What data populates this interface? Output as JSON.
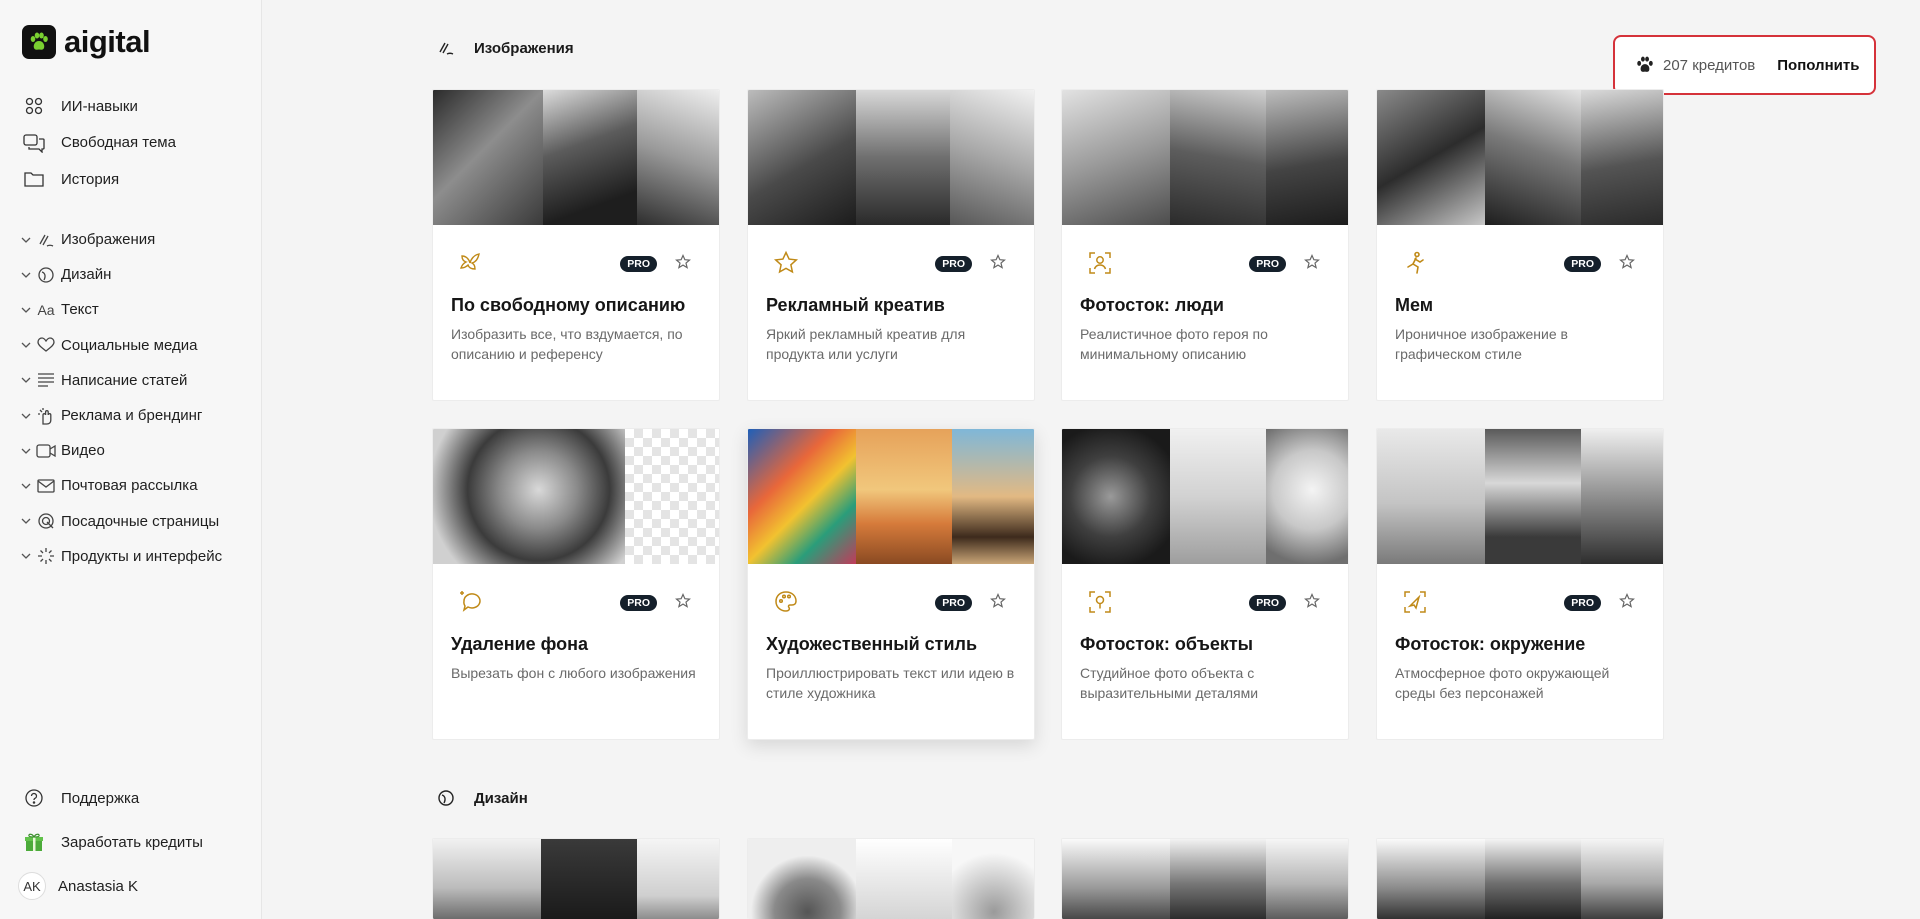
{
  "app": {
    "name": "aigital"
  },
  "sidebar": {
    "top": [
      {
        "label": "ИИ-навыки",
        "icon": "grid-icon"
      },
      {
        "label": "Свободная тема",
        "icon": "chat-icon"
      },
      {
        "label": "История",
        "icon": "folder-icon"
      }
    ],
    "categories": [
      {
        "label": "Изображения",
        "icon": "brush-icon"
      },
      {
        "label": "Дизайн",
        "icon": "palette-icon"
      },
      {
        "label": "Текст",
        "icon": "text-icon",
        "glyph": "Aa"
      },
      {
        "label": "Социальные медиа",
        "icon": "heart-icon"
      },
      {
        "label": "Написание статей",
        "icon": "lines-icon"
      },
      {
        "label": "Реклама и брендинг",
        "icon": "hand-icon"
      },
      {
        "label": "Видео",
        "icon": "video-icon"
      },
      {
        "label": "Почтовая рассылка",
        "icon": "mail-icon"
      },
      {
        "label": "Посадочные страницы",
        "icon": "target-icon"
      },
      {
        "label": "Продукты и интерфейс",
        "icon": "sparkle-icon"
      }
    ],
    "bottom": {
      "support": "Поддержка",
      "earn": "Заработать кредиты",
      "user_initials": "AK",
      "user_name": "Anastasia K"
    }
  },
  "credits": {
    "amount": "207 кредитов",
    "topup": "Пополнить"
  },
  "sections": [
    {
      "title": "Изображения",
      "cards": [
        {
          "title": "По свободному описанию",
          "desc": "Изобразить все, что вздумается, по описанию и референсу",
          "badge": "PRO",
          "icon": "bird-icon"
        },
        {
          "title": "Рекламный креатив",
          "desc": "Яркий рекламный креатив для продукта или услуги",
          "badge": "PRO",
          "icon": "star-outline-icon"
        },
        {
          "title": "Фотосток: люди",
          "desc": "Реалистичное фото героя по минимальному описанию",
          "badge": "PRO",
          "icon": "person-frame-icon"
        },
        {
          "title": "Мем",
          "desc": "Ироничное изображение в графическом стиле",
          "badge": "PRO",
          "icon": "running-man-icon"
        },
        {
          "title": "Удаление фона",
          "desc": "Вырезать фон с любого изображения",
          "badge": "PRO",
          "icon": "magic-bubble-icon"
        },
        {
          "title": "Художественный стиль",
          "desc": "Проиллюстрировать текст или идею в стиле художника",
          "badge": "PRO",
          "icon": "palette-card-icon"
        },
        {
          "title": "Фотосток: объекты",
          "desc": "Студийное фото объекта с выразительными деталями",
          "badge": "PRO",
          "icon": "object-frame-icon"
        },
        {
          "title": "Фотосток: окружение",
          "desc": "Атмосферное фото окружающей среды без персонажей",
          "badge": "PRO",
          "icon": "navigation-icon"
        }
      ]
    },
    {
      "title": "Дизайн"
    }
  ],
  "colors": {
    "accent": "#c08a18",
    "badge": "#15202b",
    "credits_border": "#d5323a"
  }
}
